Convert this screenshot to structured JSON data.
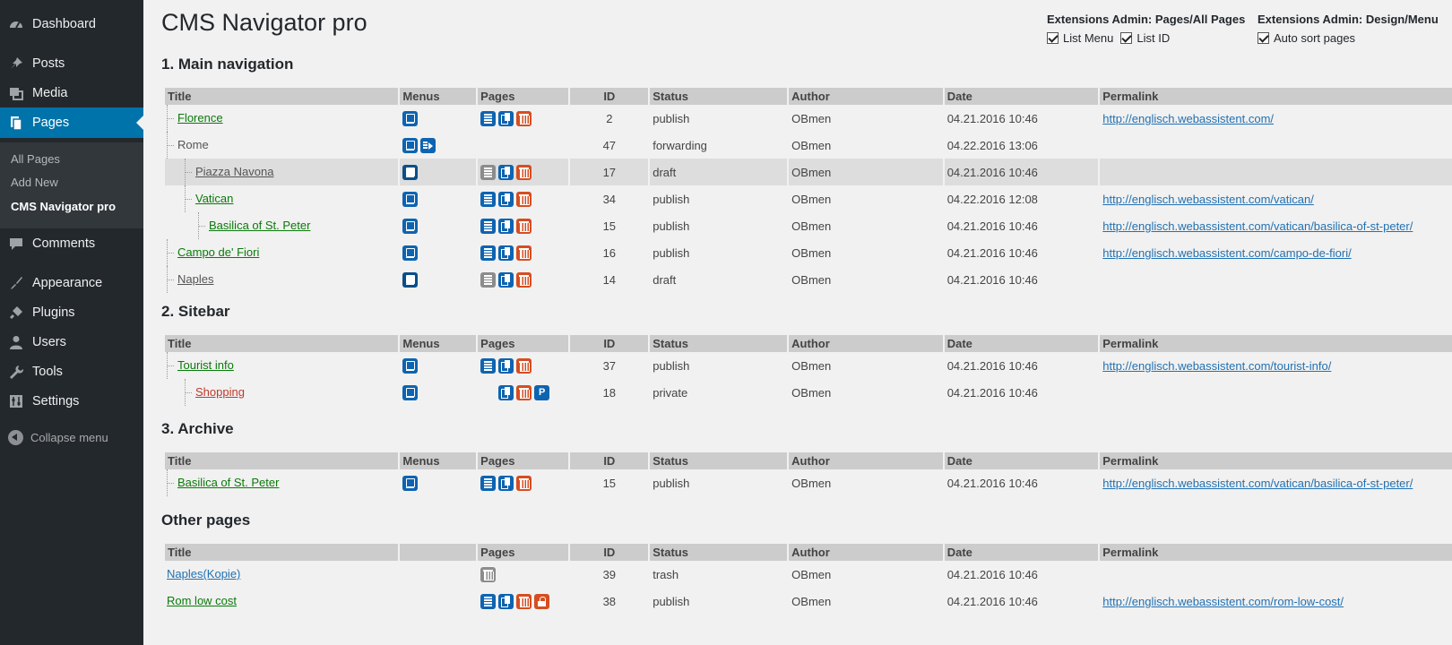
{
  "sidebar": {
    "items": [
      {
        "label": "Dashboard",
        "icon": "dashboard-icon"
      },
      {
        "label": "Posts",
        "icon": "pin-icon"
      },
      {
        "label": "Media",
        "icon": "media-icon"
      },
      {
        "label": "Pages",
        "icon": "pages-icon"
      },
      {
        "label": "Comments",
        "icon": "comment-icon"
      },
      {
        "label": "Appearance",
        "icon": "brush-icon"
      },
      {
        "label": "Plugins",
        "icon": "plug-icon"
      },
      {
        "label": "Users",
        "icon": "user-icon"
      },
      {
        "label": "Tools",
        "icon": "wrench-icon"
      },
      {
        "label": "Settings",
        "icon": "settings-icon"
      }
    ],
    "submenu": [
      "All Pages",
      "Add New",
      "CMS Navigator pro"
    ],
    "collapse_label": "Collapse menu",
    "accent": "#0073aa"
  },
  "page_title": "CMS Navigator pro",
  "extensions": {
    "pages": {
      "title": "Extensions Admin: Pages/All Pages",
      "list_menu": "List Menu",
      "list_id": "List ID"
    },
    "design": {
      "title": "Extensions Admin: Design/Menu",
      "auto_sort": "Auto sort pages"
    }
  },
  "columns": {
    "title": "Title",
    "menus": "Menus",
    "pages": "Pages",
    "id": "ID",
    "status": "Status",
    "author": "Author",
    "date": "Date",
    "permalink": "Permalink"
  },
  "sections": [
    {
      "title": "1. Main navigation",
      "rows": [
        {
          "title": "Florence",
          "menus": [
            "menu"
          ],
          "pages": [
            "edit",
            "copy",
            "trash"
          ],
          "id": "2",
          "status": "publish",
          "author": "OBmen",
          "date": "04.21.2016 10:46",
          "permalink": "http://englisch.webassistent.com/"
        },
        {
          "title": "Rome",
          "menus": [
            "menu",
            "forward"
          ],
          "pages": [],
          "id": "47",
          "status": "forwarding",
          "author": "OBmen",
          "date": "04.22.2016 13:06",
          "permalink": ""
        },
        {
          "title": "Piazza Navona",
          "menus": [
            "menu-filled"
          ],
          "pages": [
            "edit-grey",
            "copy",
            "trash"
          ],
          "id": "17",
          "status": "draft",
          "author": "OBmen",
          "date": "04.21.2016 10:46",
          "permalink": ""
        },
        {
          "title": "Vatican",
          "menus": [
            "menu"
          ],
          "pages": [
            "edit",
            "copy",
            "trash"
          ],
          "id": "34",
          "status": "publish",
          "author": "OBmen",
          "date": "04.22.2016 12:08",
          "permalink": "http://englisch.webassistent.com/vatican/"
        },
        {
          "title": "Basilica of St. Peter",
          "menus": [
            "menu"
          ],
          "pages": [
            "edit",
            "copy",
            "trash"
          ],
          "id": "15",
          "status": "publish",
          "author": "OBmen",
          "date": "04.21.2016 10:46",
          "permalink": "http://englisch.webassistent.com/vatican/basilica-of-st-peter/"
        },
        {
          "title": "Campo de' Fiori",
          "menus": [
            "menu"
          ],
          "pages": [
            "edit",
            "copy",
            "trash"
          ],
          "id": "16",
          "status": "publish",
          "author": "OBmen",
          "date": "04.21.2016 10:46",
          "permalink": "http://englisch.webassistent.com/campo-de-fiori/"
        },
        {
          "title": "Naples",
          "menus": [
            "menu-filled"
          ],
          "pages": [
            "edit-grey",
            "copy",
            "trash"
          ],
          "id": "14",
          "status": "draft",
          "author": "OBmen",
          "date": "04.21.2016 10:46",
          "permalink": ""
        }
      ]
    },
    {
      "title": "2. Sitebar",
      "rows": [
        {
          "title": "Tourist info",
          "menus": [
            "menu"
          ],
          "pages": [
            "edit",
            "copy",
            "trash"
          ],
          "id": "37",
          "status": "publish",
          "author": "OBmen",
          "date": "04.21.2016 10:46",
          "permalink": "http://englisch.webassistent.com/tourist-info/"
        },
        {
          "title": "Shopping",
          "menus": [
            "menu"
          ],
          "pages": [
            "copy",
            "trash",
            "private"
          ],
          "id": "18",
          "status": "private",
          "author": "OBmen",
          "date": "04.21.2016 10:46",
          "permalink": ""
        }
      ]
    },
    {
      "title": "3. Archive",
      "rows": [
        {
          "title": "Basilica of St. Peter",
          "menus": [
            "menu"
          ],
          "pages": [
            "edit",
            "copy",
            "trash"
          ],
          "id": "15",
          "status": "publish",
          "author": "OBmen",
          "date": "04.21.2016 10:46",
          "permalink": "http://englisch.webassistent.com/vatican/basilica-of-st-peter/"
        }
      ]
    },
    {
      "title": "Other pages",
      "rows": [
        {
          "title": "Naples(Kopie)",
          "menus": [],
          "pages": [
            "trash-grey"
          ],
          "id": "39",
          "status": "trash",
          "author": "OBmen",
          "date": "04.21.2016 10:46",
          "permalink": ""
        },
        {
          "title": "Rom low cost",
          "menus": [],
          "pages": [
            "edit",
            "copy",
            "trash",
            "lock"
          ],
          "id": "38",
          "status": "publish",
          "author": "OBmen",
          "date": "04.21.2016 10:46",
          "permalink": "http://englisch.webassistent.com/rom-low-cost/"
        }
      ]
    }
  ],
  "private_glyph": "P",
  "status_colors": {
    "publish": "#0a7a0a",
    "draft": "#555555",
    "private": "#c0392b",
    "trash": "#2271b1"
  }
}
